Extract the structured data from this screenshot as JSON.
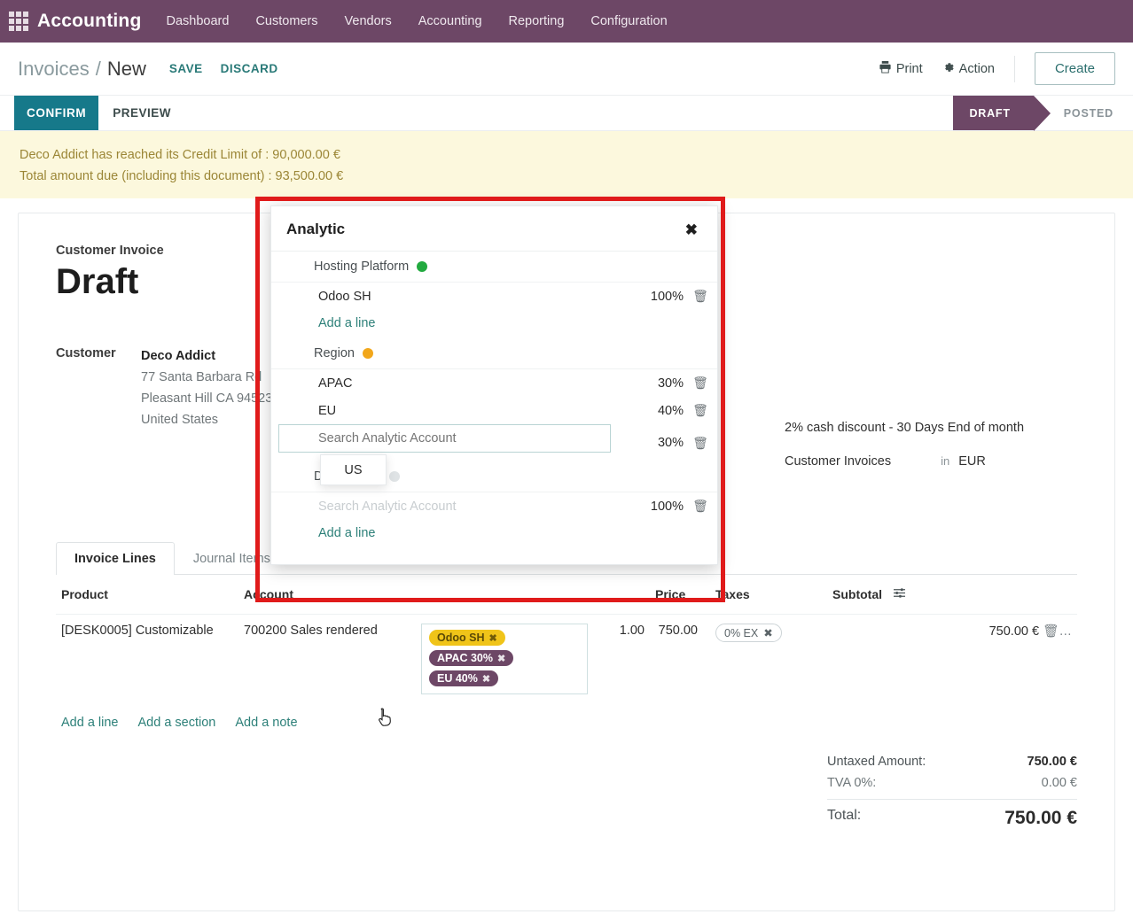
{
  "navbar": {
    "apps_icon": "apps-grid-icon",
    "brand": "Accounting",
    "menu": [
      {
        "label": "Dashboard"
      },
      {
        "label": "Customers"
      },
      {
        "label": "Vendors"
      },
      {
        "label": "Accounting"
      },
      {
        "label": "Reporting"
      },
      {
        "label": "Configuration"
      }
    ]
  },
  "control_panel": {
    "breadcrumb_root": "Invoices",
    "breadcrumb_sep": "/",
    "breadcrumb_current": "New",
    "save_label": "SAVE",
    "discard_label": "DISCARD",
    "print_label": "Print",
    "print_icon": "printer-icon",
    "action_label": "Action",
    "action_icon": "gear-icon",
    "create_label": "Create"
  },
  "statusbar": {
    "confirm_label": "CONFIRM",
    "preview_label": "PREVIEW",
    "stages": [
      {
        "label": "DRAFT",
        "active": true
      },
      {
        "label": "POSTED",
        "active": false
      }
    ]
  },
  "alert": {
    "line1": "Deco Addict has reached its Credit Limit of : 90,000.00 €",
    "line2": "Total amount due (including this document) : 93,500.00 €",
    "bg_color": "#fcf8dd",
    "text_color": "#9b8636"
  },
  "document": {
    "type_label": "Customer Invoice",
    "state_title": "Draft",
    "customer_label": "Customer",
    "customer_name": "Deco Addict",
    "customer_street": "77 Santa Barbara Rd",
    "customer_city": "Pleasant Hill CA 94523",
    "customer_country": "United States",
    "payment_terms": "2% cash discount - 30 Days End of month",
    "journal": "Customer Invoices",
    "in_label": "in",
    "currency": "EUR"
  },
  "notebook": {
    "tabs": [
      {
        "label": "Invoice Lines",
        "active": true
      },
      {
        "label": "Journal Items",
        "active": false
      }
    ],
    "columns": {
      "product": "Product",
      "account": "Account",
      "quantity": "1.00",
      "price": "Price",
      "taxes": "Taxes",
      "subtotal": "Subtotal"
    },
    "row": {
      "product": "[DESK0005] Customizable",
      "account": "700200 Sales rendered",
      "analytic_tags": [
        {
          "label": "Odoo SH",
          "color": "yellow"
        },
        {
          "label": "APAC 30%",
          "color": "purple"
        },
        {
          "label": "EU 40%",
          "color": "purple"
        }
      ],
      "quantity": "1.00",
      "price": "750.00",
      "tax": "0% EX",
      "subtotal": "750.00 €"
    },
    "add_line": "Add a line",
    "add_section": "Add a section",
    "add_note": "Add a note"
  },
  "totals": {
    "untaxed_label": "Untaxed Amount:",
    "untaxed_value": "750.00 €",
    "tax_label": "TVA 0%:",
    "tax_value": "0.00 €",
    "total_label": "Total:",
    "total_value": "750.00 €"
  },
  "analytic_modal": {
    "title": "Analytic",
    "close_icon": "close-icon",
    "search_placeholder": "Search Analytic Account",
    "add_line_label": "Add a line",
    "plans": [
      {
        "name": "Hosting Platform",
        "dot_color": "#22aa3f",
        "rows": [
          {
            "name": "Odoo SH",
            "percent": "100%"
          }
        ],
        "add_line": "Add a line"
      },
      {
        "name": "Region",
        "dot_color": "#f2a71b",
        "rows": [
          {
            "name": "APAC",
            "percent": "30%"
          },
          {
            "name": "EU",
            "percent": "40%"
          },
          {
            "name": "",
            "percent": "30%",
            "editing": true
          }
        ]
      },
      {
        "name": "Department",
        "dot_color": "#dfe3e5",
        "rows": [
          {
            "name": "Search Analytic Account",
            "percent": "100%",
            "placeholder": true
          }
        ],
        "add_line": "Add a line"
      }
    ],
    "dropdown": {
      "options": [
        {
          "label": "US"
        }
      ]
    }
  },
  "highlight": {
    "color": "#e01b1b"
  }
}
